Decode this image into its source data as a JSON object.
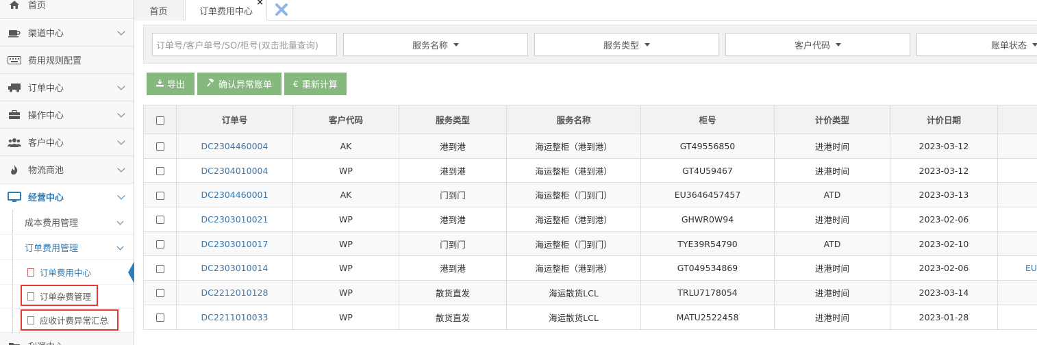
{
  "sidebar": {
    "items": [
      {
        "label": "首页",
        "icon": "home-icon"
      },
      {
        "label": "渠道中心",
        "icon": "coffee-icon"
      },
      {
        "label": "费用规则配置",
        "icon": "keyboard-icon"
      },
      {
        "label": "订单中心",
        "icon": "truck-icon"
      },
      {
        "label": "操作中心",
        "icon": "briefcase-icon"
      },
      {
        "label": "客户中心",
        "icon": "users-icon"
      },
      {
        "label": "物流商池",
        "icon": "fire-icon"
      },
      {
        "label": "经营中心",
        "icon": "monitor-icon"
      },
      {
        "label": "利润中心",
        "icon": "folder-icon"
      }
    ],
    "sub_items": [
      {
        "label": "成本费用管理"
      },
      {
        "label": "订单费用管理"
      }
    ],
    "leaf_items": [
      {
        "label": "订单费用中心"
      },
      {
        "label": "订单杂费管理"
      },
      {
        "label": "应收计费异常汇总"
      }
    ]
  },
  "tabs": {
    "home_label": "首页",
    "current_label": "订单费用中心",
    "close_glyph": "×"
  },
  "filters": {
    "order_placeholder": "订单号/客户单号/SO/柜号(双击批量查询)",
    "service_name": "服务名称",
    "service_type": "服务类型",
    "customer_code": "客户代码",
    "bill_status": "账单状态"
  },
  "toolbar": {
    "export_label": "导出",
    "confirm_label": "确认异常账单",
    "recalc_label": "重新计算"
  },
  "table": {
    "headers": [
      "订单号",
      "客户代码",
      "服务类型",
      "服务名称",
      "柜号",
      "计价类型",
      "计价日期"
    ],
    "rows": [
      [
        "DC2304460004",
        "AK",
        "港到港",
        "海运整柜（港到港）",
        "GT49556850",
        "进港时间",
        "2023-03-12"
      ],
      [
        "DC2304010004",
        "WP",
        "港到港",
        "海运整柜（港到港）",
        "GT4U59467",
        "进港时间",
        "2023-03-12"
      ],
      [
        "DC2304460001",
        "AK",
        "门到门",
        "海运整柜（门到门）",
        "EU3646457457",
        "ATD",
        "2023-03-13"
      ],
      [
        "DC2303010021",
        "WP",
        "港到港",
        "海运整柜（港到港）",
        "GHWR0W94",
        "进港时间",
        "2023-02-06"
      ],
      [
        "DC2303010017",
        "WP",
        "门到门",
        "海运整柜（门到门）",
        "TYE39R54790",
        "ATD",
        "2023-02-10"
      ],
      [
        "DC2303010014",
        "WP",
        "港到港",
        "海运整柜（港到港）",
        "GT049534869",
        "进港时间",
        "2023-02-06"
      ],
      [
        "DC2212010128",
        "WP",
        "散货直发",
        "海运散货LCL",
        "TRLU7178054",
        "进港时间",
        "2023-03-14"
      ],
      [
        "DC2211010033",
        "WP",
        "散货直发",
        "海运散货LCL",
        "MATU2522458",
        "进港时间",
        "2023-01-28"
      ]
    ],
    "row6_extra": "EU"
  },
  "colors": {
    "accent": "#2b7dbc",
    "button_green": "#87b87f",
    "highlight_red": "#e53935",
    "link_blue": "#337ab7"
  }
}
